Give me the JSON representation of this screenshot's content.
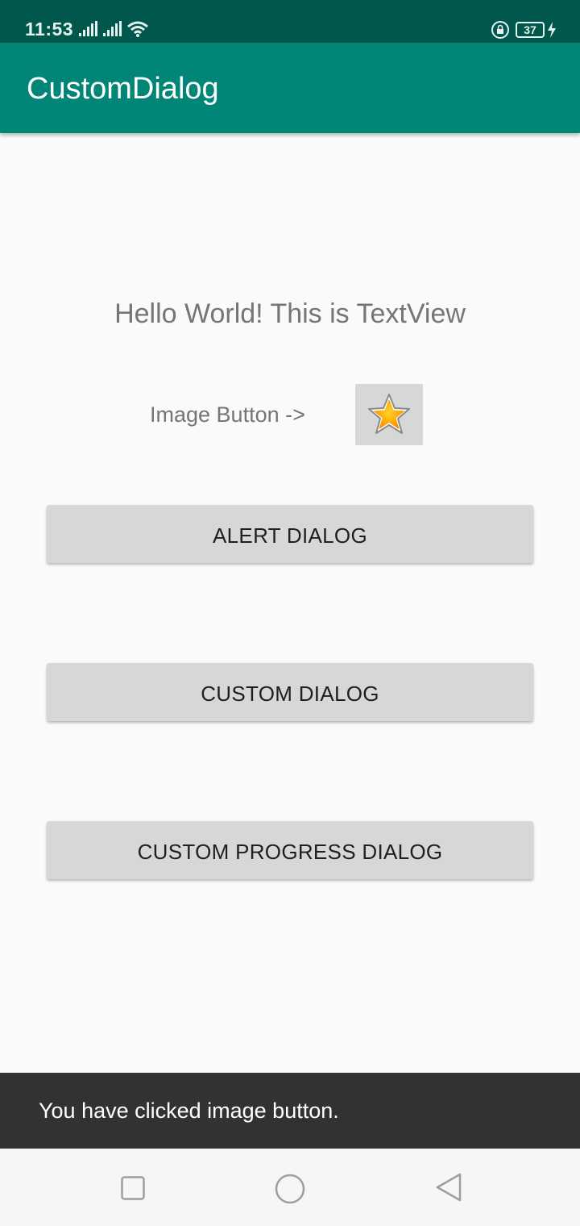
{
  "status_bar": {
    "time": "11:53",
    "battery_level": "37",
    "icons": [
      "signal-icon",
      "signal-icon",
      "wifi-icon",
      "rotation-lock-icon",
      "battery-icon",
      "charging-icon"
    ]
  },
  "app_bar": {
    "title": "CustomDialog"
  },
  "content": {
    "hello_text": "Hello World! This is TextView",
    "image_button_label": "Image Button ->",
    "image_button_icon": "star-icon",
    "buttons": [
      {
        "label": "ALERT DIALOG"
      },
      {
        "label": "CUSTOM DIALOG"
      },
      {
        "label": "CUSTOM PROGRESS DIALOG"
      }
    ]
  },
  "toast": {
    "message": "You have clicked image button."
  },
  "nav_bar": {
    "icons": [
      "recent-apps-icon",
      "home-icon",
      "back-icon"
    ]
  },
  "colors": {
    "status_bar": "#00574b",
    "app_bar": "#008577",
    "button_bg": "#d6d7d7",
    "toast_bg": "#323232",
    "background": "#fafafa"
  }
}
